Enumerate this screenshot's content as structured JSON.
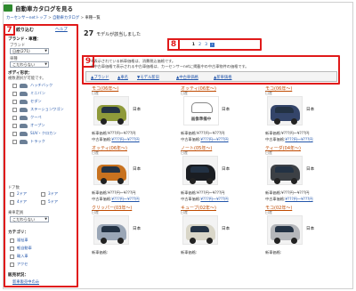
{
  "header": {
    "title": "自動車カタログを見る"
  },
  "breadcrumb": {
    "items": [
      "カーセンサーnetトップ",
      "自動車カタログ",
      "車種一覧"
    ]
  },
  "annotations": {
    "sidebar_num": "7",
    "pager_num": "8",
    "filter_num": "9"
  },
  "sidebar": {
    "title": "絞り込む",
    "help": "ヘルプ",
    "section_brand": "ブランド・車種：",
    "brand_label": "ブランド",
    "brand_value": "日産(271)",
    "model_label": "車種",
    "model_value": "こだわらない",
    "section_body": "ボディ形状：",
    "body_hint": "複数選択が可能です。",
    "body_types": [
      "ハッチバック",
      "ミニバン",
      "セダン",
      "ステーションワゴン",
      "クーペ",
      "オープン",
      "SUV・クロカン",
      "トラック"
    ],
    "doors_label": "ドア数",
    "doors": [
      "2ドア",
      "3ドア",
      "4ドア",
      "5ドア"
    ],
    "capacity_label": "乗車定員",
    "capacity_value": "こだわらない",
    "section_category": "カテゴリ：",
    "categories": [
      "福祉車",
      "軽自動車",
      "輸入車",
      "アクセ"
    ],
    "section_sale": "販売状況：",
    "sale_link": "新車販売中のみ"
  },
  "main": {
    "count": "27",
    "count_text": "モデルが該当しました",
    "pages": [
      "1",
      "2",
      "3"
    ],
    "notes": [
      "※表示されている新車価格は、消費税込価格です。",
      "※中古車価格で表示される中古車価格は、カーセンサーnetに掲載中の中古車物件の価格です。"
    ],
    "filter_tabs": [
      "ブランド",
      "車名",
      "モデル新旧",
      "中古車価格",
      "新車価格"
    ]
  },
  "cards": [
    {
      "title": "モコ(06年〜)",
      "maker": "日産",
      "country": "日本",
      "new": "新車価格:¥???円〜¥???円",
      "used": "中古車価格:",
      "used_link": "¥???円〜¥???円",
      "color": "#8f9a3a"
    },
    {
      "title": "オッティ(06年〜)",
      "maker": "日産",
      "country": "日本",
      "new": "新車価格:¥???円〜¥???円",
      "used": "中古車価格:",
      "used_link": "¥???円〜¥???円",
      "prep": true,
      "prep_text": "画像準備中"
    },
    {
      "title": "モコ(06年〜)",
      "maker": "日産",
      "country": "日本",
      "new": "新車価格:¥???円〜¥???円",
      "used": "中古車価格:",
      "used_link": "¥???円〜¥???円",
      "color": "#34456a"
    },
    {
      "title": "オッティ(06年〜)",
      "maker": "日産",
      "country": "日本",
      "new": "新車価格:¥???円〜¥???円",
      "used": "中古車価格:",
      "used_link": "¥???円〜¥???円",
      "color": "#c8721f"
    },
    {
      "title": "ノート(05年〜)",
      "maker": "日産",
      "country": "日本",
      "new": "新車価格:¥???円〜¥???円",
      "used": "中古車価格:",
      "used_link": "¥???円〜¥???円",
      "color": "#1a1d22"
    },
    {
      "title": "ティーダ(04年〜)",
      "maker": "日産",
      "country": "日本",
      "new": "新車価格:¥???円〜¥???円",
      "used": "中古車価格:",
      "used_link": "¥???円〜¥???円",
      "color": "#3c4045"
    },
    {
      "title": "クリッパー(03年〜)",
      "maker": "日産",
      "country": "日本",
      "new": "新車価格:",
      "used": "",
      "used_link": "",
      "color": "#9aa6b6"
    },
    {
      "title": "キューブ(02年〜)",
      "maker": "日産",
      "country": "日本",
      "new": "新車価格:",
      "used": "",
      "used_link": "",
      "color": "#d9d6c8"
    },
    {
      "title": "モコ(02年〜)",
      "maker": "日産",
      "country": "日本",
      "new": "新車価格:",
      "used": "",
      "used_link": "",
      "color": "#b5b7bb"
    }
  ]
}
